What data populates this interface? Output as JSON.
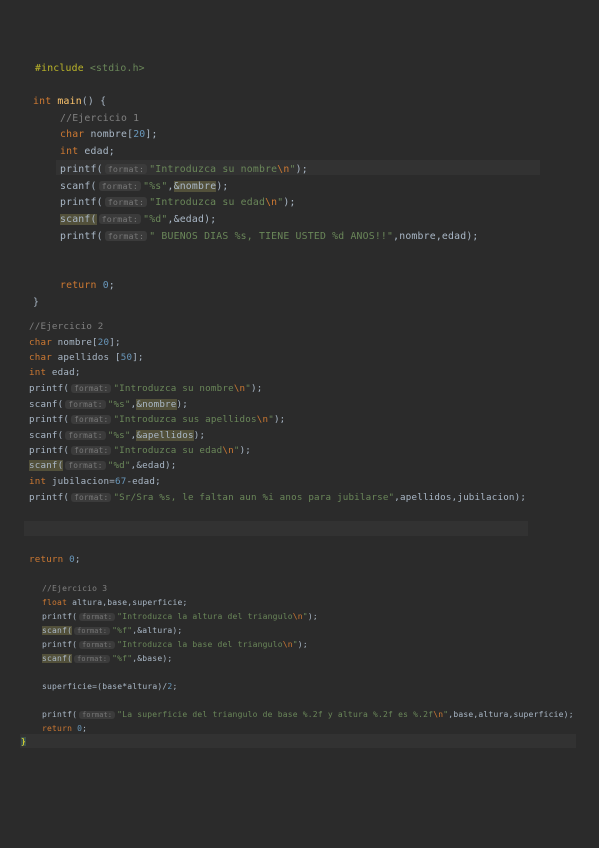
{
  "code": {
    "s1_include": {
      "kw": "#include",
      "hdr": " <stdio.h>"
    },
    "s1_main": {
      "kw": "int",
      "name": " main",
      "rest": "() {"
    },
    "s1_c1": "//Ejercicio 1",
    "s1_char": {
      "kw": "char",
      "rest": " nombre[",
      "num": "20",
      "end": "];"
    },
    "s1_int": {
      "kw": "int",
      "rest": " edad;"
    },
    "s1_p1": {
      "fn": "printf(",
      "hint": "format:",
      "str": "\"Introduzca su nombre",
      "esc": "\\n",
      "close": "\"",
      "end": ");"
    },
    "s1_s1": {
      "fn": "scanf(",
      "hint": "format:",
      "str": "\"%s\"",
      "rest": ",",
      "var": "&nombre",
      "end": ");"
    },
    "s1_p2": {
      "fn": "printf(",
      "hint": "format:",
      "str": "\"Introduzca su edad",
      "esc": "\\n",
      "close": "\"",
      "end": ");"
    },
    "s1_s2": {
      "fn": "scanf(",
      "hint": "format:",
      "str": "\"%d\"",
      "rest": ",&edad);"
    },
    "s1_p3": {
      "fn": "printf(",
      "hint": "format:",
      "str": "\" BUENOS DIAS %s, TIENE USTED %d ANOS!!\"",
      "rest": ",nombre,edad);"
    },
    "s1_ret": {
      "kw": "return",
      "num": " 0",
      "end": ";"
    },
    "s1_close": "}",
    "s2_c": "//Ejercicio 2",
    "s2_char1": {
      "kw": "char",
      "rest": " nombre[",
      "num": "20",
      "end": "];"
    },
    "s2_char2": {
      "kw": "char",
      "rest": " apellidos [",
      "num": "50",
      "end": "];"
    },
    "s2_int": {
      "kw": "int",
      "rest": " edad;"
    },
    "s2_p1": {
      "fn": "printf(",
      "hint": "format:",
      "str": "\"Introduzca su nombre",
      "esc": "\\n",
      "close": "\"",
      "end": ");"
    },
    "s2_s1": {
      "fn": "scanf(",
      "hint": "format:",
      "str": "\"%s\"",
      "rest": ",",
      "var": "&nombre",
      "end": ");"
    },
    "s2_p2": {
      "fn": "printf(",
      "hint": "format:",
      "str": "\"Introduzca sus apellidos",
      "esc": "\\n",
      "close": "\"",
      "end": ");"
    },
    "s2_s2": {
      "fn": "scanf(",
      "hint": "format:",
      "str": "\"%s\"",
      "rest": ",",
      "var": "&apellidos",
      "end": ");"
    },
    "s2_p3": {
      "fn": "printf(",
      "hint": "format:",
      "str": "\"Introduzca su edad",
      "esc": "\\n",
      "close": "\"",
      "end": ");"
    },
    "s2_s3": {
      "fn": "scanf(",
      "hint": "format:",
      "str": "\"%d\"",
      "rest": ",&edad);"
    },
    "s2_int2": {
      "kw": "int",
      "rest": " jubilacion=",
      "num": "67",
      "end": "-edad;"
    },
    "s2_p4": {
      "fn": "printf(",
      "hint": "format:",
      "str": "\"Sr/Sra %s, le faltan aun %i anos para jubilarse\"",
      "rest": ",apellidos,jubilacion);"
    },
    "s2_ret": {
      "kw": "return",
      "num": " 0",
      "end": ";"
    },
    "s3_c": "//Ejercicio 3",
    "s3_float": {
      "kw": "float",
      "rest": " altura,base,superficie;"
    },
    "s3_p1": {
      "fn": "printf(",
      "hint": "format:",
      "str": "\"Introduzca la altura del triangulo",
      "esc": "\\n",
      "close": "\"",
      "end": ");"
    },
    "s3_s1": {
      "fn": "scanf(",
      "hint": "format:",
      "str": "\"%f\"",
      "rest": ",&altura);"
    },
    "s3_p2": {
      "fn": "printf(",
      "hint": "format:",
      "str": "\"Introduzca la base del triangulo",
      "esc": "\\n",
      "close": "\"",
      "end": ");"
    },
    "s3_s2": {
      "fn": "scanf(",
      "hint": "format:",
      "str": "\"%f\"",
      "rest": ",&base);"
    },
    "s3_calc": {
      "rest": "superficie=(base*altura)/",
      "num": "2",
      "end": ";"
    },
    "s3_p3": {
      "fn": "printf(",
      "hint": "format:",
      "str": "\"La superficie del triangulo de base %.2f y altura %.2f es %.2f",
      "esc": "\\n",
      "close": "\"",
      "rest": ",base,altura,superficie);"
    },
    "s3_ret": {
      "kw": "return",
      "num": " 0",
      "end": ";"
    },
    "s3_close": "}"
  },
  "colors": {
    "background": "#2b2b2b",
    "keyword": "#cc7832",
    "string": "#6a8759",
    "number": "#6897bb",
    "comment": "#808080",
    "preprocessor": "#bbb529",
    "text": "#a9b7c6"
  }
}
